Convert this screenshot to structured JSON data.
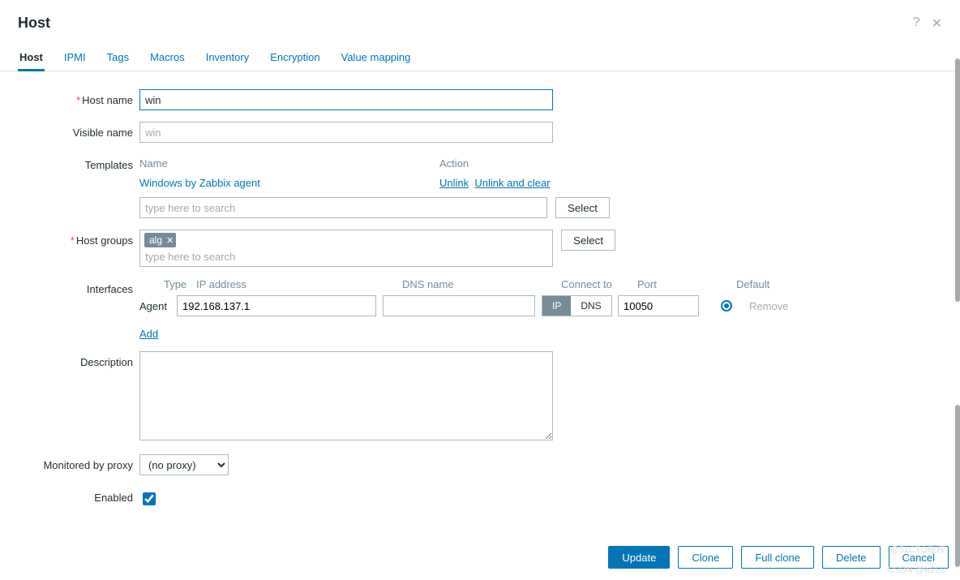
{
  "title": "Host",
  "tabs": [
    "Host",
    "IPMI",
    "Tags",
    "Macros",
    "Inventory",
    "Encryption",
    "Value mapping"
  ],
  "active_tab": 0,
  "labels": {
    "host_name": "Host name",
    "visible_name": "Visible name",
    "templates": "Templates",
    "host_groups": "Host groups",
    "interfaces": "Interfaces",
    "description": "Description",
    "proxy": "Monitored by proxy",
    "enabled": "Enabled"
  },
  "host_name": "win",
  "visible_name_value": "",
  "visible_name_placeholder": "win",
  "templates": {
    "headers": {
      "name": "Name",
      "action": "Action"
    },
    "items": [
      {
        "name": "Windows by Zabbix agent",
        "actions": [
          "Unlink",
          "Unlink and clear"
        ]
      }
    ],
    "search_placeholder": "type here to search",
    "select": "Select"
  },
  "host_groups": {
    "tags": [
      "alg"
    ],
    "search_placeholder": "type here to search",
    "select": "Select"
  },
  "interfaces": {
    "headers": {
      "type": "Type",
      "ip": "IP address",
      "dns": "DNS name",
      "connect": "Connect to",
      "port": "Port",
      "default": "Default"
    },
    "items": [
      {
        "type": "Agent",
        "ip": "192.168.137.1",
        "dns": "",
        "connect_to": "IP",
        "options": [
          "IP",
          "DNS"
        ],
        "port": "10050",
        "default": true,
        "remove": "Remove"
      }
    ],
    "add": "Add"
  },
  "description": "",
  "proxy": {
    "selected": "(no proxy)"
  },
  "enabled": true,
  "buttons": {
    "update": "Update",
    "clone": "Clone",
    "full_clone": "Full clone",
    "delete": "Delete",
    "cancel": "Cancel"
  },
  "watermarks": [
    "@51CTO版权",
    "CSDN @w262"
  ]
}
